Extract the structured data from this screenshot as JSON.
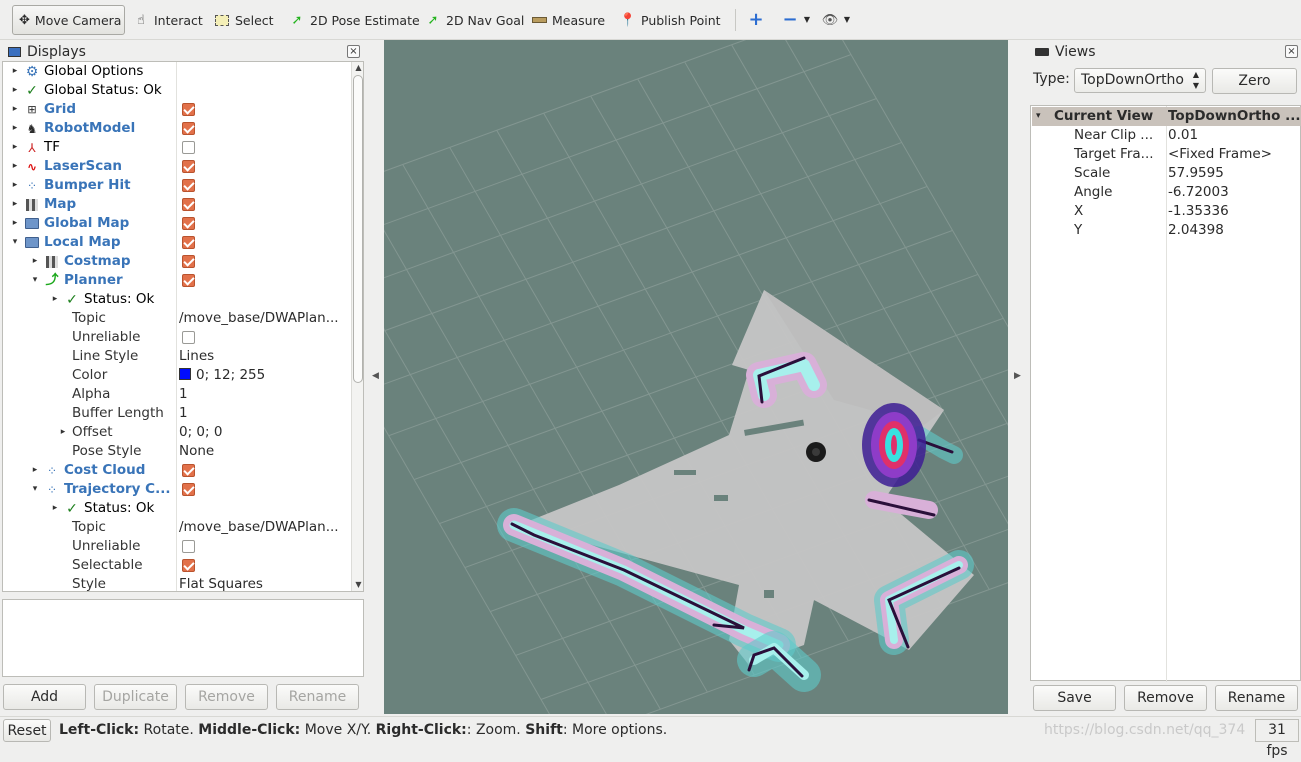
{
  "toolbar": {
    "move_camera": "Move Camera",
    "interact": "Interact",
    "select": "Select",
    "pose_estimate": "2D Pose Estimate",
    "nav_goal": "2D Nav Goal",
    "measure": "Measure",
    "publish_point": "Publish Point"
  },
  "displays": {
    "title": "Displays",
    "rows": [
      {
        "label": "Global Options",
        "value": "",
        "indent": 0,
        "arrow": "▸",
        "icon": "gear",
        "style": "dark"
      },
      {
        "label": "Global Status: Ok",
        "value": "",
        "indent": 0,
        "arrow": "▸",
        "icon": "check",
        "style": "dark"
      },
      {
        "label": "Grid",
        "value": "",
        "indent": 0,
        "arrow": "▸",
        "icon": "grid",
        "style": "blue",
        "check": true
      },
      {
        "label": "RobotModel",
        "value": "",
        "indent": 0,
        "arrow": "▸",
        "icon": "robot",
        "style": "blue",
        "check": true
      },
      {
        "label": "TF",
        "value": "",
        "indent": 0,
        "arrow": "▸",
        "icon": "tf",
        "style": "dark",
        "check": false
      },
      {
        "label": "LaserScan",
        "value": "",
        "indent": 0,
        "arrow": "▸",
        "icon": "laser",
        "style": "blue",
        "check": true
      },
      {
        "label": "Bumper Hit",
        "value": "",
        "indent": 0,
        "arrow": "▸",
        "icon": "points",
        "style": "blue",
        "check": true
      },
      {
        "label": "Map",
        "value": "",
        "indent": 0,
        "arrow": "▸",
        "icon": "map",
        "style": "blue",
        "check": true
      },
      {
        "label": "Global Map",
        "value": "",
        "indent": 0,
        "arrow": "▸",
        "icon": "folder",
        "style": "blue",
        "check": true
      },
      {
        "label": "Local Map",
        "value": "",
        "indent": 0,
        "arrow": "▾",
        "icon": "folder",
        "style": "blue",
        "check": true
      },
      {
        "label": "Costmap",
        "value": "",
        "indent": 1,
        "arrow": "▸",
        "icon": "map",
        "style": "blue",
        "check": true
      },
      {
        "label": "Planner",
        "value": "",
        "indent": 1,
        "arrow": "▾",
        "icon": "path",
        "style": "blue",
        "check": true
      },
      {
        "label": "Status: Ok",
        "value": "",
        "indent": 2,
        "arrow": "▸",
        "icon": "check",
        "style": "dark"
      },
      {
        "label": "Topic",
        "value": "/move_base/DWAPlan...",
        "indent": 2,
        "arrow": "",
        "icon": "",
        "style": "plain"
      },
      {
        "label": "Unreliable",
        "value": "",
        "indent": 2,
        "arrow": "",
        "icon": "",
        "style": "plain",
        "check": false
      },
      {
        "label": "Line Style",
        "value": "Lines",
        "indent": 2,
        "arrow": "",
        "icon": "",
        "style": "plain"
      },
      {
        "label": "Color",
        "value": "0; 12; 255",
        "indent": 2,
        "arrow": "",
        "icon": "",
        "style": "plain",
        "swatch": "#000cff"
      },
      {
        "label": "Alpha",
        "value": "1",
        "indent": 2,
        "arrow": "",
        "icon": "",
        "style": "plain"
      },
      {
        "label": "Buffer Length",
        "value": "1",
        "indent": 2,
        "arrow": "",
        "icon": "",
        "style": "plain"
      },
      {
        "label": "Offset",
        "value": "0; 0; 0",
        "indent": 2,
        "arrow": "▸",
        "icon": "",
        "style": "plain"
      },
      {
        "label": "Pose Style",
        "value": "None",
        "indent": 2,
        "arrow": "",
        "icon": "",
        "style": "plain"
      },
      {
        "label": "Cost Cloud",
        "value": "",
        "indent": 1,
        "arrow": "▸",
        "icon": "points",
        "style": "blue",
        "check": true
      },
      {
        "label": "Trajectory C...",
        "value": "",
        "indent": 1,
        "arrow": "▾",
        "icon": "points",
        "style": "blue",
        "check": true
      },
      {
        "label": "Status: Ok",
        "value": "",
        "indent": 2,
        "arrow": "▸",
        "icon": "check",
        "style": "dark"
      },
      {
        "label": "Topic",
        "value": "/move_base/DWAPlan...",
        "indent": 2,
        "arrow": "",
        "icon": "",
        "style": "plain"
      },
      {
        "label": "Unreliable",
        "value": "",
        "indent": 2,
        "arrow": "",
        "icon": "",
        "style": "plain",
        "check": false
      },
      {
        "label": "Selectable",
        "value": "",
        "indent": 2,
        "arrow": "",
        "icon": "",
        "style": "plain",
        "check": true
      },
      {
        "label": "Style",
        "value": "Flat Squares",
        "indent": 2,
        "arrow": "",
        "icon": "",
        "style": "plain"
      }
    ],
    "buttons": {
      "add": "Add",
      "duplicate": "Duplicate",
      "remove": "Remove",
      "rename": "Rename"
    }
  },
  "views": {
    "title": "Views",
    "type_label": "Type:",
    "type_value": "TopDownOrtho",
    "zero_button": "Zero",
    "header": {
      "name": "Current View",
      "value": "TopDownOrtho ..."
    },
    "rows": [
      {
        "label": "Near Clip ...",
        "value": "0.01"
      },
      {
        "label": "Target Fra...",
        "value": "<Fixed Frame>"
      },
      {
        "label": "Scale",
        "value": "57.9595"
      },
      {
        "label": "Angle",
        "value": "-6.72003"
      },
      {
        "label": "X",
        "value": "-1.35336"
      },
      {
        "label": "Y",
        "value": "2.04398"
      }
    ],
    "buttons": {
      "save": "Save",
      "remove": "Remove",
      "rename": "Rename"
    }
  },
  "statusbar": {
    "reset": "Reset",
    "left_click_key": "Left-Click:",
    "left_click_val": " Rotate. ",
    "middle_click_key": "Middle-Click:",
    "middle_click_val": " Move X/Y. ",
    "right_click_key": "Right-Click:",
    "right_click_val": ": Zoom. ",
    "shift_key": "Shift",
    "shift_val": ": More options.",
    "watermark": "https://blog.csdn.net/qq_374",
    "fps": "31 fps"
  },
  "colors": {
    "viewport_bg": "#6a827c",
    "map_free": "#c4c4c4",
    "link_blue": "#3974b8",
    "check_orange": "#e2714a"
  }
}
